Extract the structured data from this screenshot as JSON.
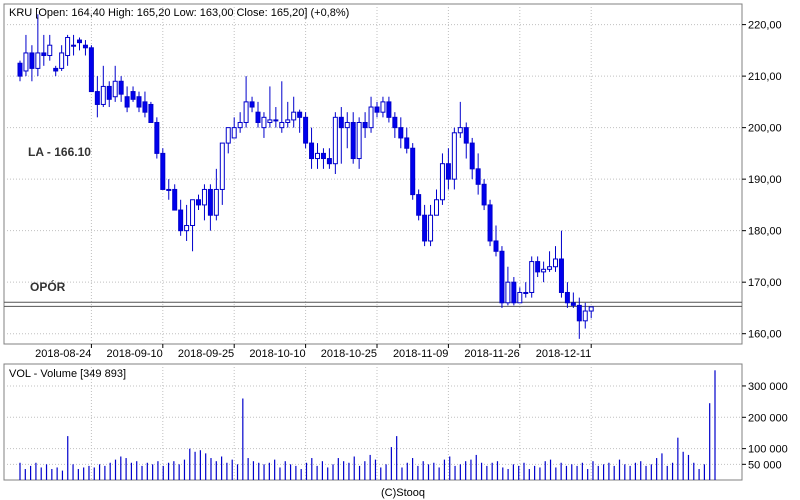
{
  "header": {
    "price_label": "KRU [Open: 164,40  High: 165,20  Low: 163,00  Close: 165,20] (+0,8%)",
    "volume_label": "VOL - Volume [349 893]",
    "footer": "(C)Stooq"
  },
  "annotations": {
    "la": "LA - 166.10",
    "resistance": "OPÓR"
  },
  "colors": {
    "bullish": "#ffffff",
    "bearish": "#0000ee",
    "outline": "#0000cc",
    "volume": "#0000cc",
    "grid": "#c0c0c0",
    "frame": "#808080"
  },
  "chart_data": [
    {
      "type": "candlestick",
      "ylim": [
        158,
        224
      ],
      "y_ticks": [
        160,
        170,
        180,
        190,
        200,
        210,
        220
      ],
      "y_tick_labels": [
        "160,00",
        "170,00",
        "180,00",
        "190,00",
        "200,00",
        "210,00",
        "220,00"
      ],
      "x_tick_labels": [
        "2018-08-24",
        "2018-09-10",
        "2018-09-25",
        "2018-10-10",
        "2018-10-25",
        "2018-11-09",
        "2018-11-26",
        "2018-12-11"
      ],
      "x_tick_index": [
        12,
        24,
        36,
        48,
        60,
        72,
        84,
        96
      ],
      "horizontal_lines": [
        166.1,
        165.3
      ],
      "ohlc": [
        [
          212.5,
          210.0,
          213.0,
          209.0
        ],
        [
          211.0,
          214.5,
          218.0,
          210.0
        ],
        [
          214.5,
          211.5,
          216.0,
          209.0
        ],
        [
          211.5,
          214.5,
          222.0,
          210.0
        ],
        [
          214.5,
          214.0,
          218.0,
          212.0
        ],
        [
          214.0,
          216.0,
          218.0,
          213.0
        ],
        [
          211.5,
          211.0,
          212.0,
          210.0
        ],
        [
          211.5,
          214.5,
          216.0,
          211.0
        ],
        [
          214.0,
          217.5,
          218.0,
          212.0
        ],
        [
          216.0,
          216.0,
          218.0,
          214.0
        ],
        [
          217.0,
          216.5,
          217.5,
          215.0
        ],
        [
          216.0,
          215.5,
          217.0,
          214.0
        ],
        [
          215.5,
          207.0,
          216.0,
          207.0
        ],
        [
          207.0,
          204.5,
          210.0,
          202.0
        ],
        [
          204.5,
          208.0,
          212.0,
          204.0
        ],
        [
          208.0,
          205.5,
          209.0,
          204.0
        ],
        [
          206.0,
          209.0,
          212.0,
          205.0
        ],
        [
          209.0,
          206.5,
          210.0,
          205.0
        ],
        [
          206.0,
          204.0,
          208.0,
          203.0
        ],
        [
          207.0,
          205.5,
          208.0,
          205.0
        ],
        [
          206.0,
          204.0,
          207.0,
          203.0
        ],
        [
          205.0,
          203.0,
          207.0,
          202.0
        ],
        [
          204.5,
          201.0,
          205.0,
          201.0
        ],
        [
          201.0,
          195.0,
          202.0,
          194.0
        ],
        [
          195.0,
          188.0,
          196.0,
          188.0
        ],
        [
          188.0,
          188.0,
          190.0,
          186.0
        ],
        [
          188.0,
          184.0,
          189.0,
          184.0
        ],
        [
          184.0,
          180.0,
          186.0,
          179.0
        ],
        [
          180.0,
          181.0,
          185.0,
          178.0
        ],
        [
          181.0,
          186.0,
          186.0,
          176.0
        ],
        [
          186.0,
          185.0,
          187.0,
          184.0
        ],
        [
          185.0,
          188.0,
          189.0,
          182.0
        ],
        [
          188.0,
          183.0,
          189.0,
          180.0
        ],
        [
          183.0,
          188.0,
          192.0,
          182.0
        ],
        [
          188.0,
          197.0,
          197.0,
          185.0
        ],
        [
          197.0,
          200.0,
          200.0,
          195.0
        ],
        [
          198.0,
          200.0,
          202.0,
          198.0
        ],
        [
          200.0,
          201.0,
          203.0,
          199.0
        ],
        [
          201.0,
          205.0,
          210.0,
          200.0
        ],
        [
          205.0,
          204.0,
          206.0,
          203.0
        ],
        [
          203.0,
          201.0,
          205.0,
          200.0
        ],
        [
          200.0,
          202.0,
          203.0,
          198.0
        ],
        [
          201.0,
          201.5,
          208.0,
          200.0
        ],
        [
          201.5,
          201.5,
          204.0,
          200.0
        ],
        [
          200.0,
          201.0,
          209.0,
          199.0
        ],
        [
          201.0,
          201.5,
          205.0,
          200.0
        ],
        [
          201.5,
          203.0,
          206.0,
          200.0
        ],
        [
          203.0,
          202.0,
          203.5,
          199.0
        ],
        [
          202.0,
          197.0,
          203.0,
          196.0
        ],
        [
          197.0,
          194.0,
          200.0,
          192.0
        ],
        [
          194.0,
          195.0,
          197.0,
          192.0
        ],
        [
          195.0,
          194.0,
          196.0,
          192.0
        ],
        [
          194.0,
          193.0,
          196.0,
          192.0
        ],
        [
          193.0,
          202.0,
          203.0,
          191.0
        ],
        [
          202.0,
          200.0,
          204.0,
          193.0
        ],
        [
          200.0,
          201.0,
          203.0,
          196.0
        ],
        [
          201.0,
          194.0,
          203.0,
          193.0
        ],
        [
          194.0,
          201.0,
          202.0,
          192.0
        ],
        [
          201.0,
          200.0,
          203.0,
          198.0
        ],
        [
          200.0,
          204.0,
          206.0,
          199.0
        ],
        [
          204.0,
          203.0,
          205.0,
          202.0
        ],
        [
          203.0,
          205.0,
          206.0,
          202.0
        ],
        [
          205.0,
          202.0,
          206.0,
          201.0
        ],
        [
          202.0,
          200.0,
          203.0,
          198.0
        ],
        [
          200.0,
          198.0,
          202.0,
          196.0
        ],
        [
          198.0,
          196.0,
          200.0,
          195.0
        ],
        [
          196.0,
          187.0,
          197.0,
          186.0
        ],
        [
          187.0,
          183.0,
          188.0,
          182.0
        ],
        [
          183.0,
          178.0,
          185.0,
          177.0
        ],
        [
          178.0,
          183.0,
          185.0,
          177.0
        ],
        [
          183.0,
          186.0,
          188.0,
          183.0
        ],
        [
          186.0,
          193.0,
          195.0,
          185.0
        ],
        [
          193.0,
          190.0,
          196.0,
          188.0
        ],
        [
          190.0,
          199.0,
          200.0,
          188.0
        ],
        [
          199.0,
          200.0,
          205.0,
          198.0
        ],
        [
          200.0,
          197.0,
          201.0,
          194.0
        ],
        [
          197.0,
          192.0,
          198.0,
          190.0
        ],
        [
          192.0,
          189.0,
          195.0,
          187.0
        ],
        [
          189.0,
          185.0,
          190.0,
          184.0
        ],
        [
          185.0,
          178.0,
          186.0,
          177.0
        ],
        [
          178.0,
          176.0,
          181.0,
          175.0
        ],
        [
          176.0,
          166.0,
          177.0,
          165.0
        ],
        [
          166.0,
          170.0,
          173.0,
          165.5
        ],
        [
          170.0,
          166.0,
          171.0,
          165.5
        ],
        [
          166.0,
          168.0,
          169.0,
          166.0
        ],
        [
          168.0,
          168.0,
          170.0,
          167.0
        ],
        [
          168.0,
          174.0,
          175.0,
          167.0
        ],
        [
          174.0,
          172.0,
          175.0,
          171.0
        ],
        [
          172.0,
          172.5,
          174.0,
          170.0
        ],
        [
          172.5,
          173.0,
          176.0,
          172.0
        ],
        [
          173.0,
          174.5,
          177.0,
          172.0
        ],
        [
          174.5,
          168.0,
          180.0,
          167.0
        ],
        [
          168.0,
          166.0,
          170.0,
          165.0
        ],
        [
          166.0,
          165.5,
          168.0,
          165.0
        ],
        [
          165.5,
          162.5,
          167.0,
          159.0
        ],
        [
          162.5,
          164.4,
          166.0,
          161.0
        ],
        [
          164.4,
          165.2,
          165.2,
          163.0
        ]
      ]
    },
    {
      "type": "bar",
      "title": "VOL - Volume [349 893]",
      "ylim": [
        0,
        370000
      ],
      "y_ticks": [
        50000,
        100000,
        200000,
        300000
      ],
      "y_tick_labels": [
        "50 000",
        "100 000",
        "200 000",
        "300 000"
      ],
      "values": [
        55000,
        35000,
        45000,
        55000,
        40000,
        50000,
        35000,
        40000,
        30000,
        140000,
        50000,
        35000,
        40000,
        45000,
        40000,
        50000,
        45000,
        55000,
        65000,
        75000,
        70000,
        55000,
        60000,
        45000,
        55000,
        50000,
        60000,
        45000,
        55000,
        60000,
        50000,
        65000,
        100000,
        90000,
        95000,
        85000,
        70000,
        60000,
        75000,
        55000,
        65000,
        50000,
        260000,
        70000,
        60000,
        55000,
        50000,
        55000,
        65000,
        40000,
        60000,
        50000,
        45000,
        35000,
        55000,
        70000,
        45000,
        60000,
        40000,
        50000,
        70000,
        60000,
        55000,
        75000,
        45000,
        60000,
        80000,
        65000,
        40000,
        50000,
        105000,
        140000,
        40000,
        55000,
        70000,
        45000,
        60000,
        50000,
        55000,
        40000,
        65000,
        75000,
        45000,
        50000,
        60000,
        65000,
        80000,
        55000,
        45000,
        55000,
        60000,
        40000,
        35000,
        50000,
        45000,
        55000,
        35000,
        45000,
        40000,
        60000,
        65000,
        40000,
        55000,
        45000,
        50000,
        45000,
        55000,
        35000,
        60000,
        45000,
        50000,
        55000,
        45000,
        65000,
        50000,
        45000,
        55000,
        60000,
        45000,
        50000,
        70000,
        85000,
        45000,
        55000,
        135000,
        90000,
        80000,
        55000,
        35000,
        50000,
        245000,
        349893
      ]
    }
  ]
}
